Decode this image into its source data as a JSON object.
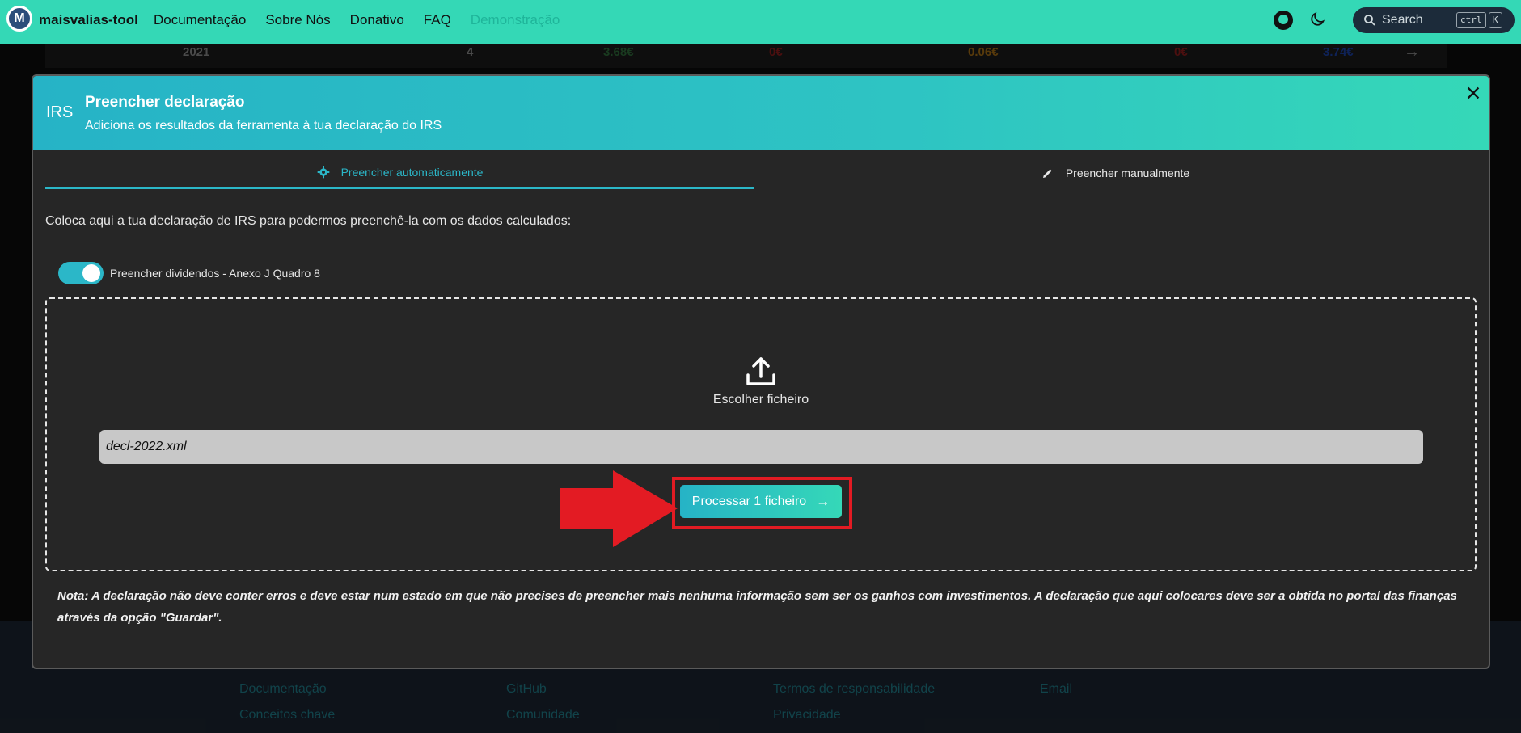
{
  "navbar": {
    "brand": "maisvalias-tool",
    "links": [
      "Documentação",
      "Sobre Nós",
      "Donativo",
      "FAQ",
      "Demonstração"
    ],
    "search_label": "Search",
    "kbd_ctrl": "ctrl",
    "kbd_k": "K"
  },
  "background_row": {
    "year": "2021",
    "count": "4",
    "v1": "3.68€",
    "v2": "0€",
    "v3": "0.06€",
    "v4": "0€",
    "v5": "3.74€"
  },
  "modal": {
    "badge": "IRS",
    "title": "Preencher declaração",
    "subtitle": "Adiciona os resultados da ferramenta à tua declaração do IRS",
    "tabs": {
      "auto": "Preencher automaticamente",
      "manual": "Preencher manualmente"
    },
    "intro": "Coloca aqui a tua declaração de IRS para podermos preenchê-la com os dados calculados:",
    "toggle_label": "Preencher dividendos - Anexo J Quadro 8",
    "toggle_on": true,
    "choose_file": "Escolher ficheiro",
    "file_name": "decl-2022.xml",
    "process_button": "Processar 1 ficheiro",
    "note": "Nota: A declaração não deve conter erros e deve estar num estado em que não precises de preencher mais nenhuma informação sem ser os ganhos com investimentos. A declaração que aqui colocares deve ser a obtida no portal das finanças através da opção \"Guardar\"."
  },
  "footer": {
    "col1": [
      "Documentação",
      "Conceitos chave"
    ],
    "col2": [
      "GitHub",
      "Comunidade"
    ],
    "col3": [
      "Termos de responsabilidade",
      "Privacidade"
    ],
    "col4": [
      "Email"
    ]
  },
  "colors": {
    "accent": "#34d8b6",
    "tab_active": "#2bb7c8",
    "highlight": "#e31b23"
  }
}
